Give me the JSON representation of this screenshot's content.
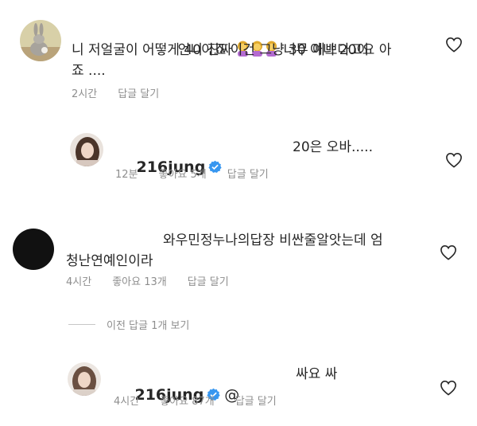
{
  "comments": [
    {
      "lines": [
        "언니 진짜 ",
        "니 저얼굴이 어떻게 40이죠 이건 그냥 30 아니 20이",
        "죠 ...."
      ],
      "line1_tail": " 너무 예쁘다고요 아",
      "emoji": [
        "woman-gesturing-emoji",
        "woman-gesturing-emoji",
        "woman-gesturing-emoji"
      ],
      "time": "2시간",
      "reply": "답글 달기"
    },
    {
      "username": "216jung",
      "text": "20은 오바.....",
      "time": "12분",
      "likes": "좋아요 5개",
      "reply": "답글 달기"
    },
    {
      "lines": [
        "와우민정누나의답장 비싼줄알앗는데 엄",
        "청난연예인이라"
      ],
      "time": "4시간",
      "likes": "좋아요 13개",
      "reply": "답글 달기"
    },
    {
      "username": "216jung",
      "mention": "@",
      "text": "싸요 싸",
      "time": "4시간",
      "likes": "좋아요 87개",
      "reply": "답글 달기"
    }
  ],
  "view_previous_replies": "이전 답글 1개 보기",
  "colors": {
    "text": "#262626",
    "meta": "#8e8e8e",
    "verified": "#3897f0"
  }
}
